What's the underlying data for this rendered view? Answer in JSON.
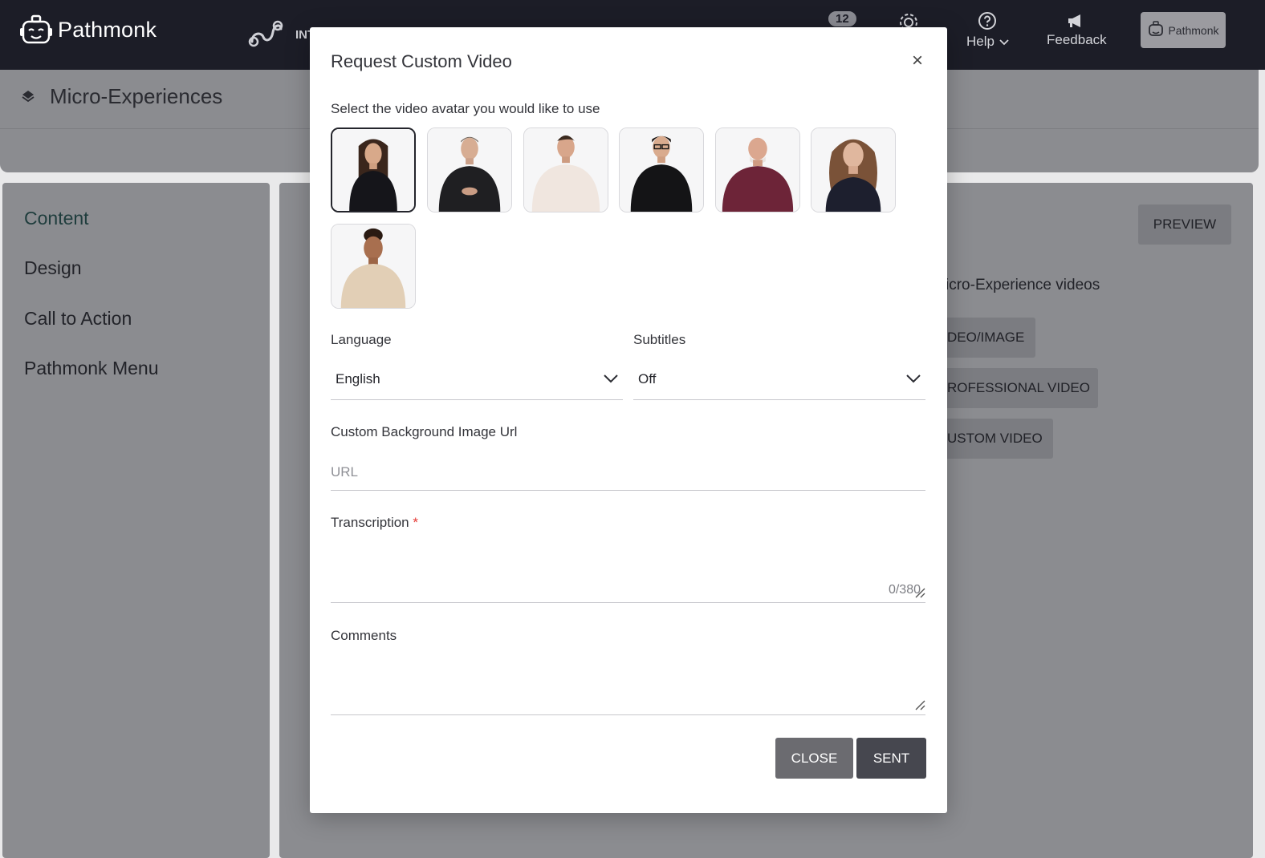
{
  "nav": {
    "brand": "Pathmonk",
    "integrations_label": "INT",
    "notifications_count": "12",
    "help_label": "Help",
    "feedback_label": "Feedback",
    "account_label": "Pathmonk"
  },
  "page": {
    "title": "Micro-Experiences"
  },
  "sidebar": {
    "items": [
      {
        "label": "Content"
      },
      {
        "label": "Design"
      },
      {
        "label": "Call to Action"
      },
      {
        "label": "Pathmonk Menu"
      }
    ]
  },
  "main": {
    "preview_label": "PREVIEW",
    "section_text": "icro-Experience videos",
    "buttons": [
      {
        "label": "DEO/IMAGE"
      },
      {
        "label": "ROFESSIONAL VIDEO"
      },
      {
        "label": "USTOM VIDEO"
      }
    ]
  },
  "modal": {
    "title": "Request Custom Video",
    "close_icon": "×",
    "avatar_prompt": "Select the video avatar you would like to use",
    "avatars": [
      {
        "name": "avatar-1",
        "selected": true
      },
      {
        "name": "avatar-2",
        "selected": false
      },
      {
        "name": "avatar-3",
        "selected": false
      },
      {
        "name": "avatar-4",
        "selected": false
      },
      {
        "name": "avatar-5",
        "selected": false
      },
      {
        "name": "avatar-6",
        "selected": false
      },
      {
        "name": "avatar-7",
        "selected": false
      }
    ],
    "language": {
      "label": "Language",
      "value": "English"
    },
    "subtitles": {
      "label": "Subtitles",
      "value": "Off"
    },
    "background_url": {
      "label": "Custom Background Image Url",
      "placeholder": "URL",
      "value": ""
    },
    "transcription": {
      "label": "Transcription",
      "required_mark": "*",
      "counter": "0/380"
    },
    "comments": {
      "label": "Comments"
    },
    "close_button": "CLOSE",
    "sent_button": "SENT"
  },
  "colors": {
    "topbar": "#1c1d27",
    "dimmed_surface": "#8b8c90",
    "primary_button": "#46474f",
    "secondary_button": "#6b6b70",
    "required": "#e53935"
  }
}
